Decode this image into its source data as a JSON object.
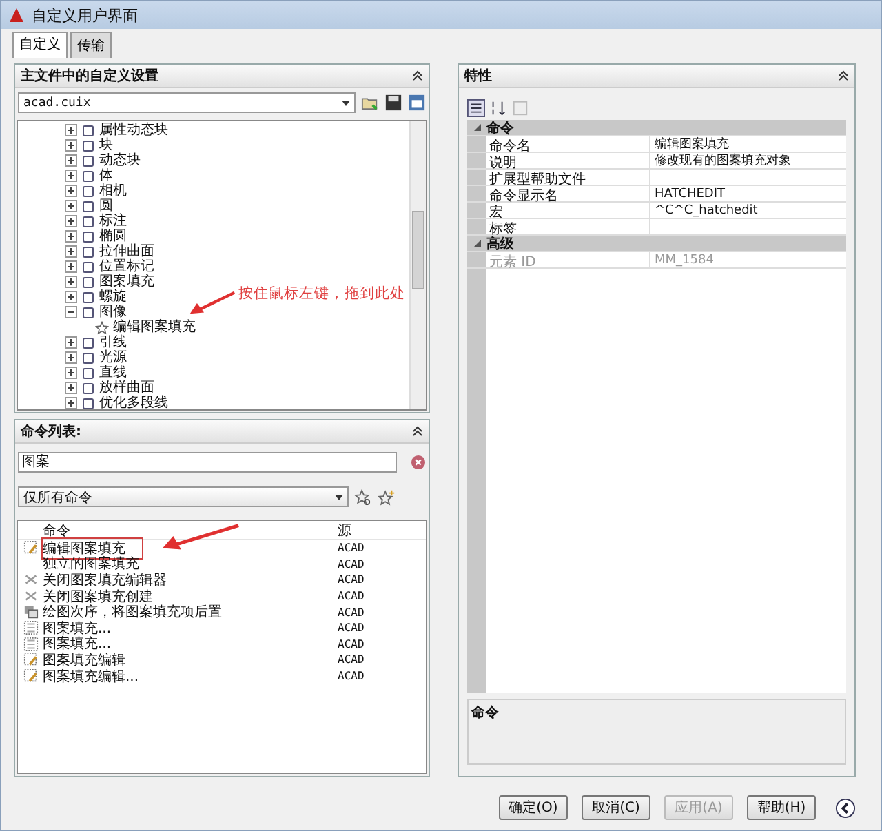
{
  "window": {
    "title": "自定义用户界面"
  },
  "tabs": [
    {
      "label": "自定义",
      "selected": true
    },
    {
      "label": "传输",
      "selected": false
    }
  ],
  "customizations": {
    "title": "主文件中的自定义设置",
    "file": "acad.cuix",
    "tree": [
      {
        "label": "属性动态块",
        "expanded": false
      },
      {
        "label": "块",
        "expanded": false
      },
      {
        "label": "动态块",
        "expanded": false
      },
      {
        "label": "体",
        "expanded": false
      },
      {
        "label": "相机",
        "expanded": false
      },
      {
        "label": "圆",
        "expanded": false
      },
      {
        "label": "标注",
        "expanded": false
      },
      {
        "label": "椭圆",
        "expanded": false
      },
      {
        "label": "拉伸曲面",
        "expanded": false
      },
      {
        "label": "位置标记",
        "expanded": false
      },
      {
        "label": "图案填充",
        "expanded": false
      },
      {
        "label": "螺旋",
        "expanded": false
      },
      {
        "label": "图像",
        "expanded": true,
        "children": [
          {
            "label": "编辑图案填充"
          }
        ]
      },
      {
        "label": "引线",
        "expanded": false
      },
      {
        "label": "光源",
        "expanded": false
      },
      {
        "label": "直线",
        "expanded": false
      },
      {
        "label": "放样曲面",
        "expanded": false
      },
      {
        "label": "优化多段线",
        "expanded": false
      }
    ],
    "annotation": "按住鼠标左键，拖到此处"
  },
  "command_list": {
    "title": "命令列表:",
    "search": "图案",
    "filter": "仅所有命令",
    "columns": [
      "命令",
      "源"
    ],
    "rows": [
      {
        "kind": "hatchedit",
        "name": "编辑图案填充",
        "source": "ACAD",
        "outlined": true
      },
      {
        "kind": "none",
        "name": "独立的图案填充",
        "source": "ACAD",
        "outlined": false
      },
      {
        "kind": "close",
        "name": "关闭图案填充编辑器",
        "source": "ACAD",
        "outlined": false
      },
      {
        "kind": "close",
        "name": "关闭图案填充创建",
        "source": "ACAD",
        "outlined": false
      },
      {
        "kind": "draworder",
        "name": "绘图次序，将图案填充项后置",
        "source": "ACAD",
        "outlined": false
      },
      {
        "kind": "hatch",
        "name": "图案填充...",
        "source": "ACAD",
        "outlined": false
      },
      {
        "kind": "hatch",
        "name": "图案填充...",
        "source": "ACAD",
        "outlined": false
      },
      {
        "kind": "hatchedit",
        "name": "图案填充编辑",
        "source": "ACAD",
        "outlined": false
      },
      {
        "kind": "hatchedit",
        "name": "图案填充编辑...",
        "source": "ACAD",
        "outlined": false
      }
    ]
  },
  "properties": {
    "title": "特性",
    "groups": [
      {
        "name": "命令",
        "rows": [
          {
            "label": "命令名",
            "value": "编辑图案填充",
            "disabled": false
          },
          {
            "label": "说明",
            "value": "修改现有的图案填充对象",
            "disabled": false
          },
          {
            "label": "扩展型帮助文件",
            "disabled": false
          },
          {
            "label": "命令显示名",
            "value": "HATCHEDIT",
            "disabled": false
          },
          {
            "label": "宏",
            "value": "^C^C_hatchedit",
            "disabled": false
          },
          {
            "label": "标签",
            "disabled": false
          }
        ]
      },
      {
        "name": "高级",
        "rows": [
          {
            "label": "元素 ID",
            "value": "MM_1584",
            "disabled": true
          }
        ]
      }
    ],
    "description_title": "命令"
  },
  "buttons": [
    {
      "label": "确定(O)",
      "disabled": false
    },
    {
      "label": "取消(C)",
      "disabled": false
    },
    {
      "label": "应用(A)",
      "disabled": true
    },
    {
      "label": "帮助(H)",
      "disabled": false
    }
  ]
}
